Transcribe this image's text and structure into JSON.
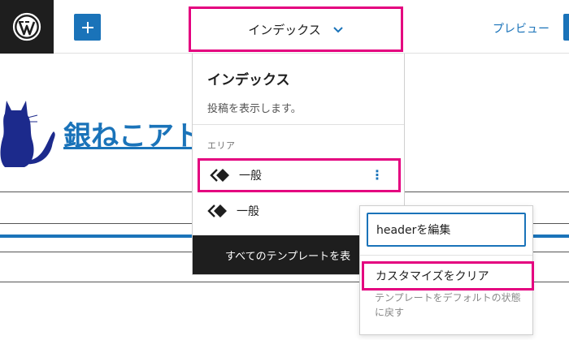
{
  "header": {
    "document_title": "インデックス",
    "preview_label": "プレビュー"
  },
  "site": {
    "title": "銀ねこアト"
  },
  "template_panel": {
    "title": "インデックス",
    "description": "投稿を表示します。",
    "area_heading": "エリア",
    "areas": [
      {
        "label": "一般"
      },
      {
        "label": "一般"
      }
    ],
    "footer_label": "すべてのテンプレートを表"
  },
  "context_menu": {
    "edit_label": "headerを編集",
    "clear_label": "カスタマイズをクリア",
    "clear_help": "テンプレートをデフォルトの状態に戻す"
  },
  "colors": {
    "accent": "#1a73b9",
    "highlight": "#e4007f",
    "dark": "#1e1e1e"
  },
  "icons": [
    "wordpress-icon",
    "plus-icon",
    "chevron-down-icon",
    "template-part-icon",
    "more-vertical-icon",
    "cat-logo-icon"
  ]
}
